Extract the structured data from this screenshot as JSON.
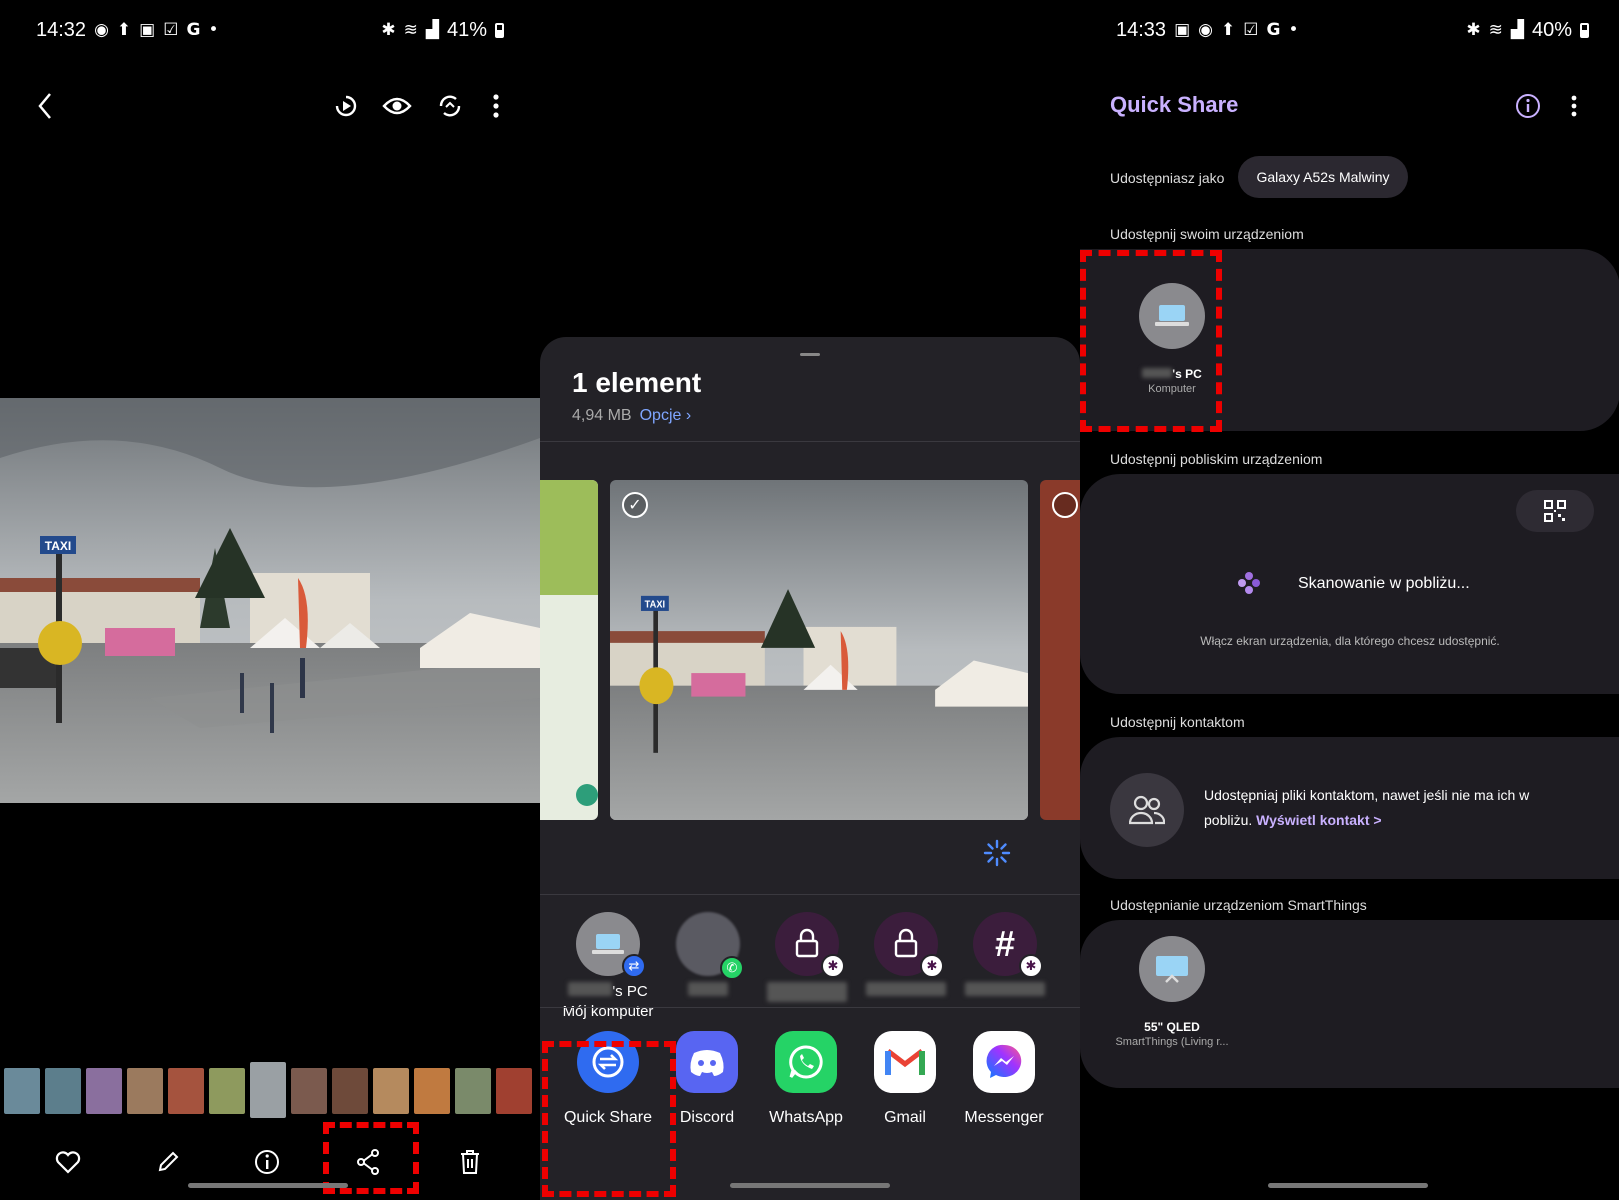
{
  "left_panel": {
    "status": {
      "time": "14:32",
      "battery": "41%"
    },
    "toolbar_icons": [
      "back-icon",
      "motion-photo-icon",
      "eye-icon",
      "remaster-icon",
      "more-icon"
    ],
    "bottom_icons": [
      "heart-icon",
      "edit-icon",
      "info-icon",
      "share-icon",
      "delete-icon"
    ]
  },
  "share_sheet": {
    "title": "1 element",
    "size": "4,94 MB",
    "options_label": "Opcje",
    "targets": [
      {
        "name_suffix": "'s PC",
        "subtitle": "Mój komputer",
        "badge": "quick-share"
      },
      {
        "name_suffix": "",
        "subtitle": "",
        "badge": "whatsapp"
      },
      {
        "name_suffix": "",
        "subtitle": "",
        "badge": "slack"
      },
      {
        "name_suffix": "",
        "subtitle": "",
        "badge": "slack"
      },
      {
        "name_suffix": "",
        "subtitle": "",
        "badge": "slack"
      }
    ],
    "apps": [
      {
        "name": "Quick Share",
        "color": "#2f6bf0"
      },
      {
        "name": "Discord",
        "color": "#5865f2"
      },
      {
        "name": "WhatsApp",
        "color": "#25d366"
      },
      {
        "name": "Gmail",
        "color": "#ffffff"
      },
      {
        "name": "Messenger",
        "color": "#ffffff"
      }
    ]
  },
  "quick_share": {
    "status": {
      "time": "14:33",
      "battery": "40%"
    },
    "title": "Quick Share",
    "share_as_label": "Udostępniasz jako",
    "device_name": "Galaxy A52s Malwiny",
    "own_devices_label": "Udostępnij swoim urządzeniom",
    "own_device": {
      "name_suffix": "'s PC",
      "type": "Komputer"
    },
    "nearby_label": "Udostępnij pobliskim urządzeniom",
    "scanning_text": "Skanowanie w pobliżu...",
    "nearby_hint": "Włącz ekran urządzenia, dla którego chcesz udostępnić.",
    "contacts_label": "Udostępnij kontaktom",
    "contacts_text": "Udostępniaj pliki kontaktom, nawet jeśli nie ma ich w pobliżu.",
    "contacts_link": "Wyświetl kontakt >",
    "smartthings_label": "Udostępnianie urządzeniom SmartThings",
    "smartthings_device": {
      "name": "55\" QLED",
      "type": "SmartThings (Living r..."
    }
  },
  "colors": {
    "accent_purple": "#c9b1ff",
    "highlight_red": "#e00000",
    "link_blue": "#7fa6ff"
  }
}
